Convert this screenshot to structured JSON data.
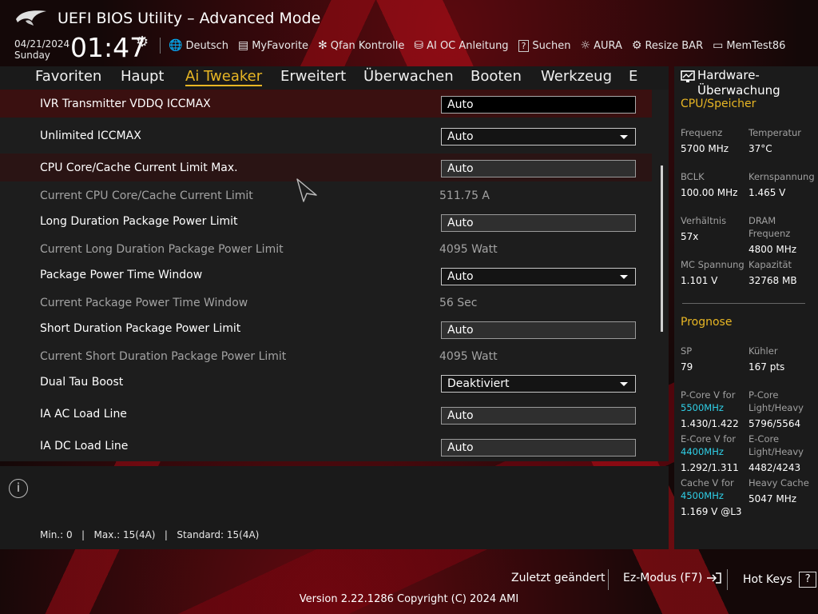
{
  "header": {
    "title": "UEFI BIOS Utility – Advanced Mode",
    "date": "04/21/2024",
    "weekday": "Sunday",
    "time": "01:47",
    "toolbar": [
      {
        "icon": "globe-icon",
        "glyph": "🌐",
        "label": "Deutsch"
      },
      {
        "icon": "favorite-icon",
        "glyph": "▤",
        "label": "MyFavorite"
      },
      {
        "icon": "fan-icon",
        "glyph": "✻",
        "label": "Qfan Kontrolle"
      },
      {
        "icon": "ai-chip-icon",
        "glyph": "⛁",
        "label": "AI OC Anleitung"
      },
      {
        "icon": "search-help-icon",
        "glyph": "?",
        "label": "Suchen"
      },
      {
        "icon": "aura-icon",
        "glyph": "☼",
        "label": "AURA"
      },
      {
        "icon": "resize-bar-icon",
        "glyph": "⚙",
        "label": "Resize BAR"
      },
      {
        "icon": "memtest-icon",
        "glyph": "▭",
        "label": "MemTest86"
      }
    ]
  },
  "tabs": [
    "Favoriten",
    "Haupt",
    "Ai Tweaker",
    "Erweitert",
    "Überwachen",
    "Booten",
    "Werkzeug",
    "E"
  ],
  "active_tab": "Ai Tweaker",
  "settings": [
    {
      "label": "IVR Transmitter VDDQ ICCMAX",
      "value": "Auto"
    },
    {
      "label": "Unlimited ICCMAX",
      "value": "Auto"
    },
    {
      "label": "CPU Core/Cache Current Limit Max.",
      "value": "Auto"
    },
    {
      "label": "Current CPU Core/Cache Current Limit",
      "value": "511.75 A"
    },
    {
      "label": "Long Duration Package Power Limit",
      "value": "Auto"
    },
    {
      "label": "Current Long Duration Package Power Limit",
      "value": "4095 Watt"
    },
    {
      "label": "Package Power Time Window",
      "value": "Auto"
    },
    {
      "label": "Current Package Power Time Window",
      "value": "56 Sec"
    },
    {
      "label": "Short Duration Package Power Limit",
      "value": "Auto"
    },
    {
      "label": "Current Short Duration Package Power Limit",
      "value": "4095 Watt"
    },
    {
      "label": "Dual Tau Boost",
      "value": "Deaktiviert"
    },
    {
      "label": "IA AC Load Line",
      "value": "Auto"
    },
    {
      "label": "IA DC Load Line",
      "value": "Auto"
    }
  ],
  "info": {
    "help_text": "Min.: 0   |   Max.: 15(4A)   |   Standard: 15(4A)"
  },
  "hw": {
    "title": "Hardware-Überwachung",
    "cpu_section": "CPU/Speicher",
    "cpu": {
      "freq_label": "Frequenz",
      "freq": "5700 MHz",
      "temp_label": "Temperatur",
      "temp": "37°C",
      "bclk_label": "BCLK",
      "bclk": "100.00 MHz",
      "vcore_label": "Kernspannung",
      "vcore": "1.465 V",
      "ratio_label": "Verhältnis",
      "ratio": "57x",
      "dram_label": "DRAM Frequenz",
      "dram": "4800 MHz",
      "mc_label": "MC Spannung",
      "mc": "1.101 V",
      "cap_label": "Kapazität",
      "cap": "32768 MB"
    },
    "prognose_section": "Prognose",
    "prognose": {
      "sp_label": "SP",
      "sp": "79",
      "cooler_label": "Kühler",
      "cooler": "167 pts",
      "pcore_v_label": "P-Core V for",
      "pcore_v_freq": "5500MHz",
      "pcore_v": "1.430/1.422",
      "pcore_lh_label": "P-Core Light/Heavy",
      "pcore_lh": "5796/5564",
      "ecore_v_label": "E-Core V for",
      "ecore_v_freq": "4400MHz",
      "ecore_v": "1.292/1.311",
      "ecore_lh_label": "E-Core Light/Heavy",
      "ecore_lh": "4482/4243",
      "cache_v_label": "Cache V for",
      "cache_v_freq": "4500MHz",
      "cache_v": "1.169 V @L3",
      "heavy_cache_label": "Heavy Cache",
      "heavy_cache": "5047 MHz"
    }
  },
  "footer": {
    "last_changed": "Zuletzt geändert",
    "ez_mode": "Ez-Modus (F7)",
    "ez_mode_icon": "exit-arrow-icon",
    "hot_keys": "Hot Keys",
    "hot_keys_key": "?",
    "version": "Version 2.22.1286 Copyright (C) 2024 AMI"
  },
  "colors": {
    "accent": "#e8b624",
    "highlight_row": "#3a1010",
    "cyan": "#2fd0e8",
    "brand_red": "#b00c18"
  }
}
